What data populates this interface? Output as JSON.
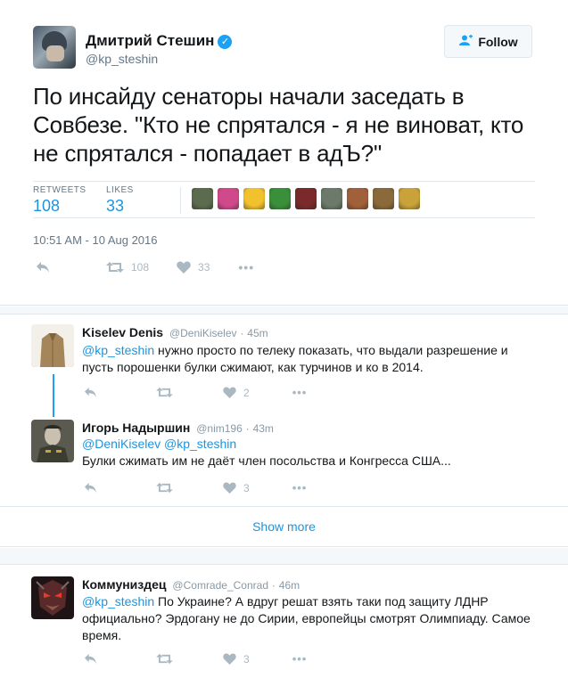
{
  "main_tweet": {
    "author_name": "Дмитрий Стешин",
    "verified_glyph": "✓",
    "author_handle": "@kp_steshin",
    "follow_label": "Follow",
    "text": "По инсайду сенаторы начали заседать в Совбезе. \"Кто не спрятался - я не виноват, кто не спрятался - попадает в адЪ?\"",
    "retweets_label": "RETWEETS",
    "retweets_count": "108",
    "likes_label": "LIKES",
    "likes_count": "33",
    "timestamp": "10:51 AM - 10 Aug 2016",
    "action_retweets": "108",
    "action_likes": "33",
    "liker_colors": [
      "#5b6b4e",
      "#d04a8a",
      "#f2c12e",
      "#3a8f3a",
      "#7a2a2a",
      "#6b7a6a",
      "#a0603a",
      "#8a6a3a",
      "#c9a23a"
    ]
  },
  "replies": [
    {
      "name": "Kiselev Denis",
      "handle": "@DeniKiselev",
      "time": "45m",
      "mention": "@kp_steshin",
      "text": "нужно просто по телеку показать, что выдали разрешение и пусть порошенки булки сжимают, как турчинов и ко в 2014.",
      "likes": "2"
    },
    {
      "name": "Игорь Надыршин",
      "handle": "@nim196",
      "time": "43m",
      "mention": "@DeniKiselev @kp_steshin",
      "text": "Булки сжимать им не даёт член посольства и Конгресса США...",
      "likes": "3"
    },
    {
      "name": "Коммуниздец",
      "handle": "@Comrade_Conrad",
      "time": "46m",
      "mention": "@kp_steshin",
      "text": "По Украине? А вдруг решат взять таки под защиту ЛДНР официально? Эрдогану не до Сирии, европейцы смотрят Олимпиаду. Самое время.",
      "likes": "3"
    }
  ],
  "show_more_label": "Show more",
  "icons": {
    "reply": "⟵",
    "retweet": "⇄",
    "like": "♥",
    "more": "•••",
    "follow": "+"
  },
  "colors": {
    "accent": "#1da1f2",
    "link": "#1b95e0",
    "muted": "#657786",
    "action": "#aab8c2"
  }
}
